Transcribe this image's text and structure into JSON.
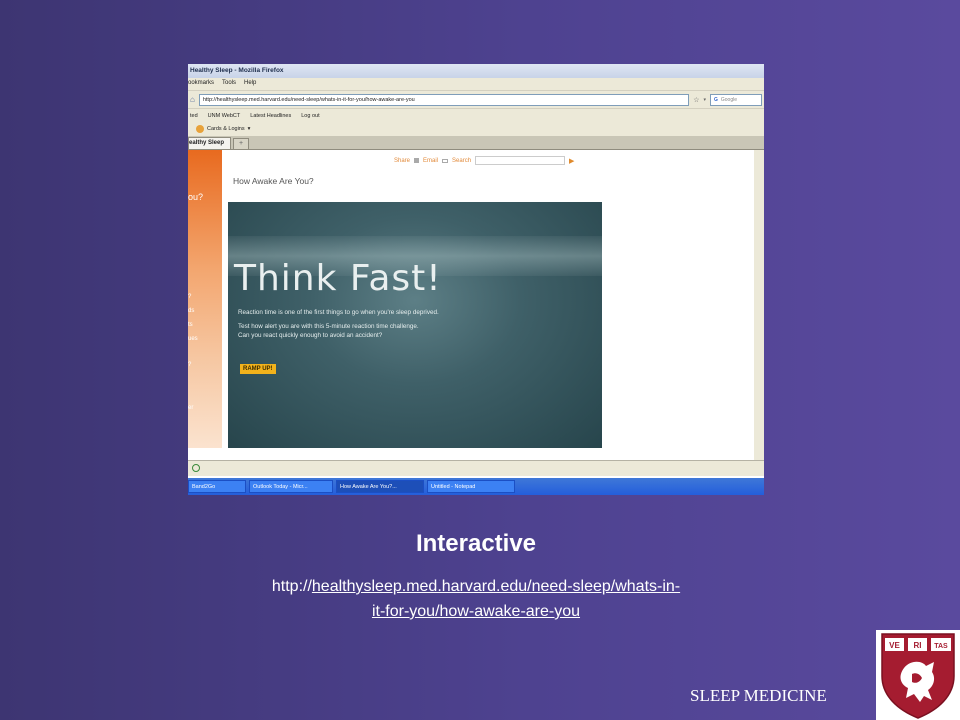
{
  "browser": {
    "window_title": "Healthy Sleep - Mozilla Firefox",
    "menu": [
      "ookmarks",
      "Tools",
      "Help"
    ],
    "url": "http://healthysleep.med.harvard.edu/need-sleep/whats-in-it-for-you/how-awake-are-you",
    "search_engine": "Google",
    "bookmarks": [
      "ted",
      "UNM WebCT",
      "Latest Headlines",
      "Log out"
    ],
    "toolbar_item": "Cards & Logins",
    "tab_label": "ealthy Sleep",
    "tab_new": "+",
    "status": ""
  },
  "page": {
    "share_items": [
      "Share",
      "Email",
      "Search"
    ],
    "side_fragments": [
      "ou?",
      "?",
      "ds",
      "ts",
      "ues",
      "?",
      "er"
    ],
    "heading": "How Awake Are You?",
    "flash": {
      "headline": "Think Fast!",
      "line1": "Reaction time is one of the first things to go when you're sleep deprived.",
      "line2": "Test how alert you are with this 5-minute reaction time challenge.",
      "line3": "Can you react quickly enough to avoid an accident?",
      "button": "RAMP UP!"
    }
  },
  "taskbar": {
    "items": [
      "Band2Go",
      "Outlook Today - Micr...",
      "How Awake Are You?...",
      "Untitled - Notepad"
    ],
    "active_index": 2
  },
  "slide": {
    "title": "Interactive",
    "url_prefix": "http://",
    "url_link_line1": "healthysleep.med.harvard.edu/need-sleep/whats-in-",
    "url_link_line2": "it-for-you/how-awake-are-you",
    "footer": "SLEEP MEDICINE",
    "shield_letters": [
      "VE",
      "RI",
      "TAS"
    ]
  },
  "colors": {
    "background_left": "#3d3572",
    "background_right": "#5a4a9e",
    "shield_red": "#a51c30",
    "ramp_button": "#f2b21b"
  }
}
